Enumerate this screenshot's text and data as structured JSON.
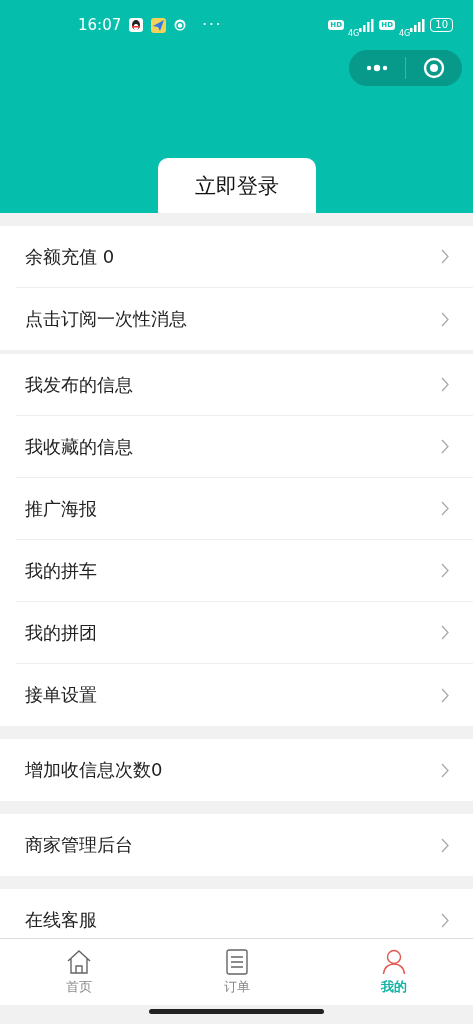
{
  "status_bar": {
    "time": "16:07",
    "dots": "···",
    "sim_labels": [
      {
        "hd": "HD",
        "net": "4G"
      },
      {
        "hd": "HD",
        "net": "4G"
      }
    ],
    "battery": "10"
  },
  "header": {
    "login_button": "立即登录"
  },
  "menu_groups": [
    {
      "items": [
        {
          "label": "余额充值 0"
        },
        {
          "label": "点击订阅一次性消息"
        }
      ]
    },
    {
      "items": [
        {
          "label": "我发布的信息"
        },
        {
          "label": "我收藏的信息"
        },
        {
          "label": "推广海报"
        },
        {
          "label": "我的拼车"
        },
        {
          "label": "我的拼团"
        },
        {
          "label": "接单设置"
        }
      ]
    },
    {
      "items": [
        {
          "label": "增加收信息次数0"
        }
      ]
    },
    {
      "items": [
        {
          "label": "商家管理后台"
        }
      ]
    },
    {
      "items": [
        {
          "label": "在线客服"
        }
      ]
    }
  ],
  "tab_bar": [
    {
      "label": "首页",
      "selected": false
    },
    {
      "label": "订单",
      "selected": false
    },
    {
      "label": "我的",
      "selected": true
    }
  ]
}
